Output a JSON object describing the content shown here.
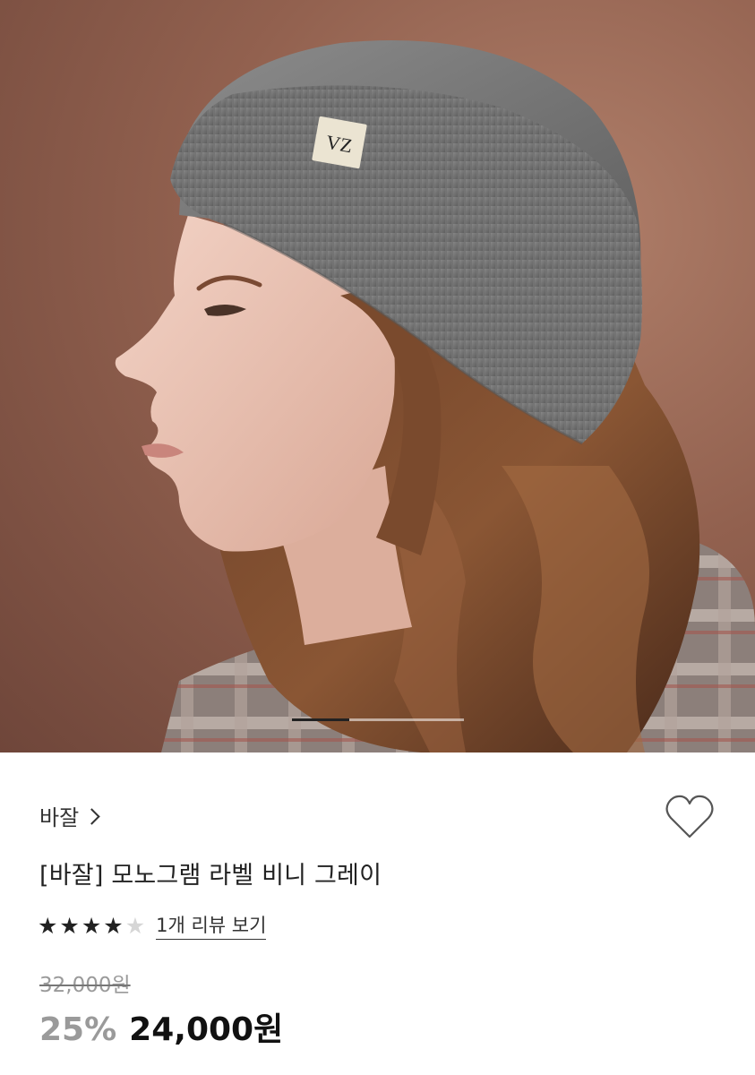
{
  "carousel": {
    "total_slides": 3,
    "current_slide": 1,
    "hat_label_monogram": "VZ"
  },
  "brand": {
    "name": "바잘"
  },
  "product": {
    "title": "[바잘] 모노그램 라벨 비니 그레이",
    "rating": 4,
    "rating_max": 5,
    "review_link_label": "1개 리뷰 보기",
    "original_price": "32,000원",
    "discount_rate": "25%",
    "sale_price": "24,000원"
  },
  "colors": {
    "background_wall": "#92614f",
    "accent_text": "#222222",
    "muted_text": "#9a9a9a"
  },
  "icons": {
    "wishlist": "heart-outline-icon",
    "brand_arrow": "chevron-right-icon",
    "rating": "star-icon"
  }
}
